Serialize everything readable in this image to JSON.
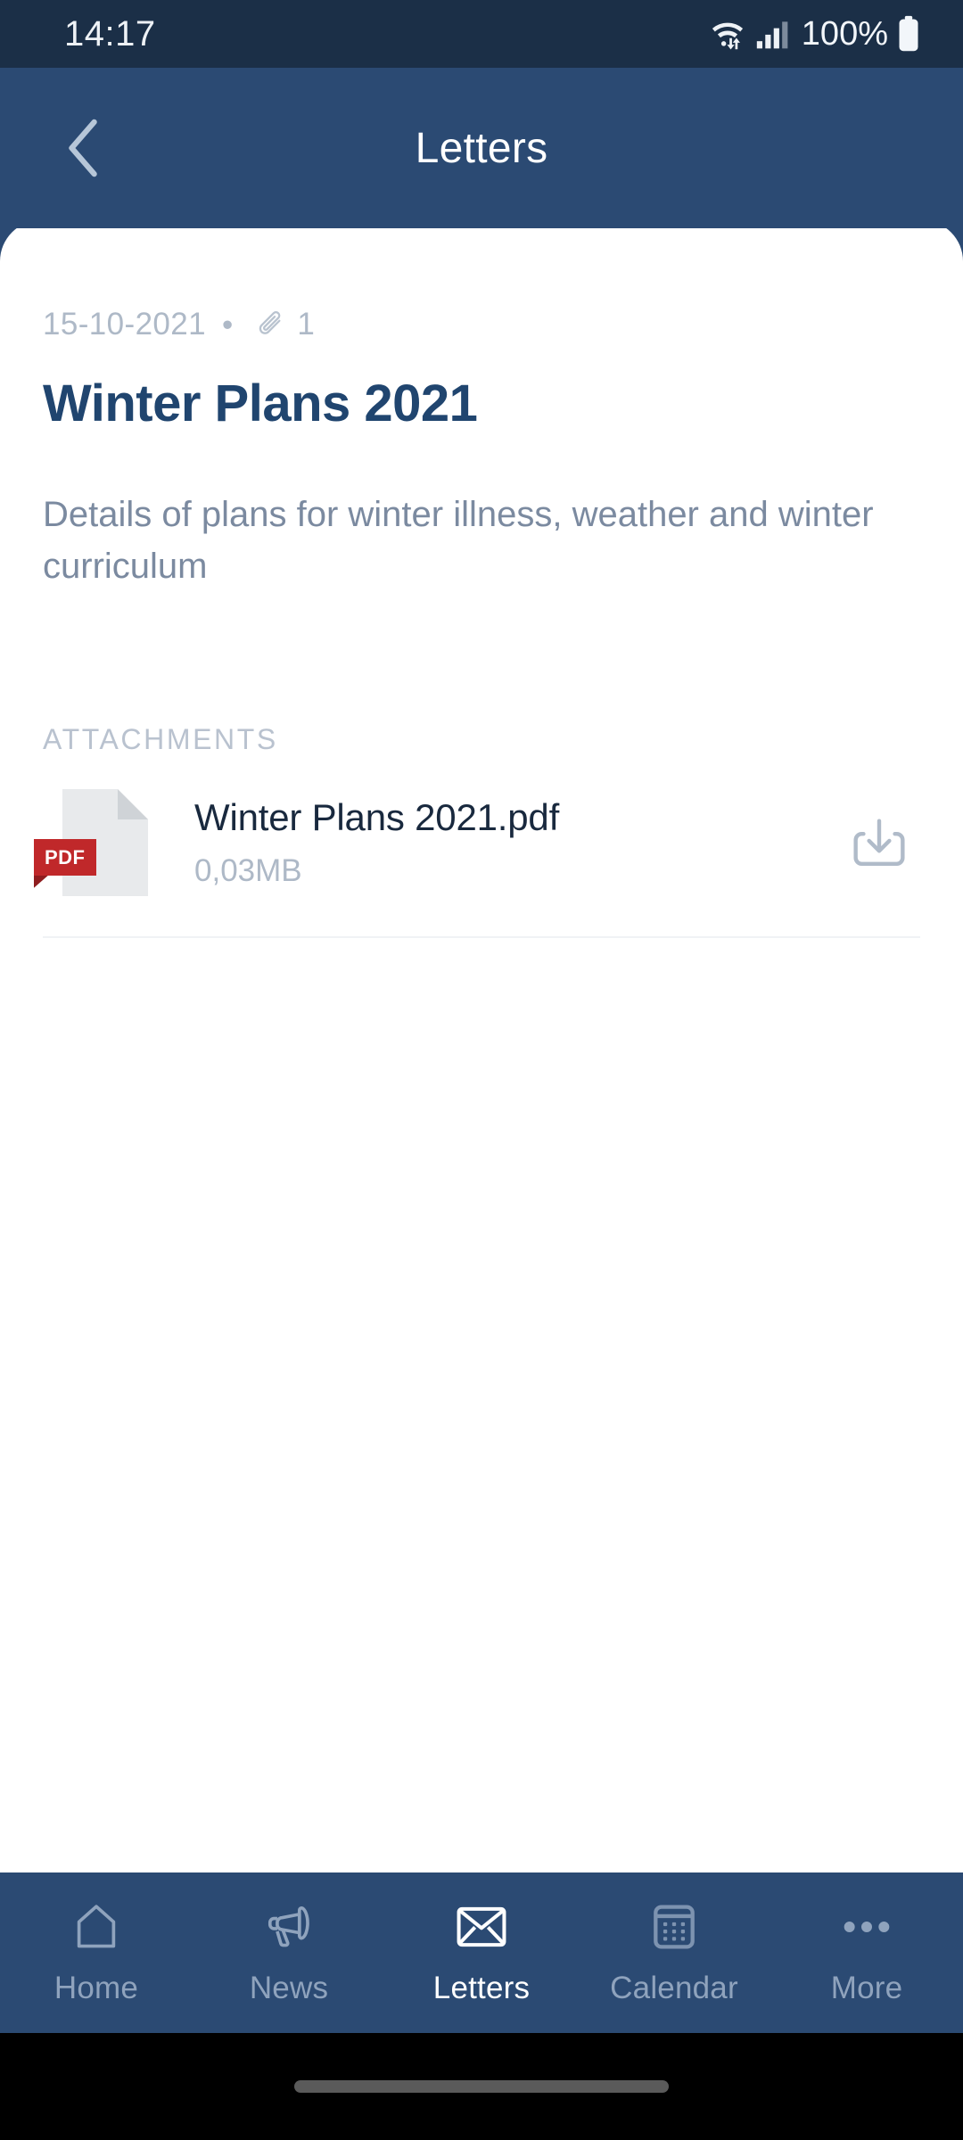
{
  "status_bar": {
    "time": "14:17",
    "battery_text": "100%",
    "icons": [
      "wifi-icon",
      "data-transfer-icon",
      "signal-icon",
      "battery-icon"
    ]
  },
  "header": {
    "title": "Letters",
    "back_icon": "chevron-left-icon"
  },
  "letter": {
    "date": "15-10-2021",
    "separator": "•",
    "attachment_icon": "paperclip-icon",
    "attachment_count": "1",
    "title": "Winter Plans 2021",
    "body": "Details of plans for winter illness, weather and winter curriculum"
  },
  "attachments_section": {
    "label": "ATTACHMENTS",
    "items": [
      {
        "file_type": "PDF",
        "name": "Winter Plans 2021.pdf",
        "size": "0,03MB",
        "download_icon": "download-icon"
      }
    ]
  },
  "bottom_nav": {
    "items": [
      {
        "label": "Home",
        "icon": "home-icon",
        "active": false
      },
      {
        "label": "News",
        "icon": "megaphone-icon",
        "active": false
      },
      {
        "label": "Letters",
        "icon": "envelope-icon",
        "active": true
      },
      {
        "label": "Calendar",
        "icon": "calendar-icon",
        "active": false
      },
      {
        "label": "More",
        "icon": "ellipsis-icon",
        "active": false
      }
    ]
  },
  "colors": {
    "status_bar_bg": "#1b2f47",
    "header_bg": "#2b4a73",
    "card_bg": "#ffffff",
    "title_navy": "#20456f",
    "muted_text": "#aeb9c7",
    "body_text": "#7b8aa0",
    "pdf_red": "#c0282a",
    "nav_inactive": "#8fa3bd",
    "nav_active": "#ffffff"
  }
}
